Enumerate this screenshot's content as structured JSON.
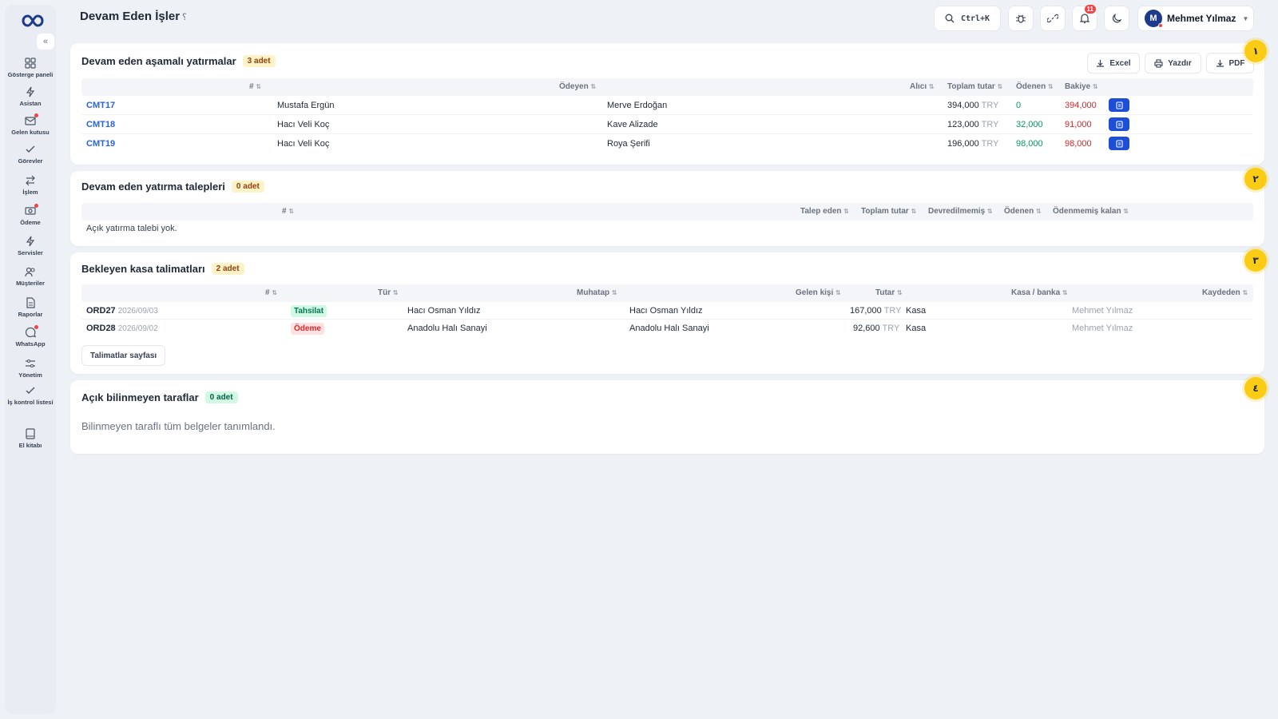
{
  "app": {
    "page_title": "Devam Eden İşler",
    "help_glyph": "؟"
  },
  "sidebar": {
    "collapse_glyph": "«",
    "items": [
      {
        "label": "Gösterge paneli",
        "icon": "dashboard-icon"
      },
      {
        "label": "Asistan",
        "icon": "bolt-icon"
      },
      {
        "label": "Gelen kutusu",
        "icon": "inbox-icon"
      },
      {
        "label": "Görevler",
        "icon": "check-icon"
      },
      {
        "label": "İşlem",
        "icon": "transfer-icon"
      },
      {
        "label": "Ödeme",
        "icon": "payment-icon"
      },
      {
        "label": "Servisler",
        "icon": "bolt-icon"
      },
      {
        "label": "Müşteriler",
        "icon": "users-icon"
      },
      {
        "label": "Raporlar",
        "icon": "report-icon"
      },
      {
        "label": "WhatsApp",
        "icon": "chat-icon"
      },
      {
        "label": "Yönetim",
        "icon": "sliders-icon"
      },
      {
        "label": "İş kontrol listesi",
        "icon": "checklist-icon"
      },
      {
        "label": "El kitabı",
        "icon": "book-icon"
      }
    ]
  },
  "topbar": {
    "search_shortcut": "Ctrl+K",
    "notification_count": "11",
    "user": {
      "initial": "M",
      "name": "Mehmet Yılmaz"
    }
  },
  "colors": {
    "accent": "#2563eb",
    "step_badge": "#facc15",
    "positive": "#059669",
    "negative": "#dc2626"
  },
  "section1": {
    "step": "١",
    "title": "Devam eden aşamalı yatırmalar",
    "count": "3 adet",
    "actions": {
      "excel": "Excel",
      "print": "Yazdır",
      "pdf": "PDF"
    },
    "headers": {
      "id": "#",
      "payer": "Ödeyen",
      "recipient": "Alıcı",
      "total": "Toplam tutar",
      "paid": "Ödenen",
      "balance": "Bakiye"
    },
    "rows": [
      {
        "id": "CMT17",
        "payer": "Mustafa Ergün",
        "recipient": "Merve Erdoğan",
        "total": "394,000",
        "currency": "TRY",
        "paid": "0",
        "balance": "394,000"
      },
      {
        "id": "CMT18",
        "payer": "Hacı Veli Koç",
        "recipient": "Kave Alizade",
        "total": "123,000",
        "currency": "TRY",
        "paid": "32,000",
        "balance": "91,000"
      },
      {
        "id": "CMT19",
        "payer": "Hacı Veli Koç",
        "recipient": "Roya Şerifi",
        "total": "196,000",
        "currency": "TRY",
        "paid": "98,000",
        "balance": "98,000"
      }
    ]
  },
  "section2": {
    "step": "٢",
    "title": "Devam eden yatırma talepleri",
    "count": "0 adet",
    "headers": {
      "id": "#",
      "requester": "Talep eden",
      "total": "Toplam tutar",
      "untransferred": "Devredilmemiş",
      "paid": "Ödenen",
      "unpaid": "Ödenmemiş kalan"
    },
    "empty": "Açık yatırma talebi yok."
  },
  "section3": {
    "step": "٣",
    "title": "Bekleyen kasa talimatları",
    "count": "2 adet",
    "headers": {
      "id": "#",
      "type": "Tür",
      "counterparty": "Muhatap",
      "receiver": "Gelen kişi",
      "amount": "Tutar",
      "account": "Kasa / banka",
      "recorder": "Kaydeden"
    },
    "rows": [
      {
        "id": "ORD27",
        "date": "2026/09/03",
        "type": "Tahsilat",
        "type_kind": "in",
        "counterparty": "Hacı Osman Yıldız",
        "receiver": "Hacı Osman Yıldız",
        "amount": "167,000",
        "currency": "TRY",
        "account": "Kasa",
        "recorder": "Mehmet Yılmaz"
      },
      {
        "id": "ORD28",
        "date": "2026/09/02",
        "type": "Ödeme",
        "type_kind": "out",
        "counterparty": "Anadolu Halı Sanayi",
        "receiver": "Anadolu Halı Sanayi",
        "amount": "92,600",
        "currency": "TRY",
        "account": "Kasa",
        "recorder": "Mehmet Yılmaz"
      }
    ],
    "link": "Talimatlar sayfası"
  },
  "section4": {
    "step": "٤",
    "title": "Açık bilinmeyen taraflar",
    "count": "0 adet",
    "empty": "Bilinmeyen taraflı tüm belgeler tanımlandı."
  }
}
